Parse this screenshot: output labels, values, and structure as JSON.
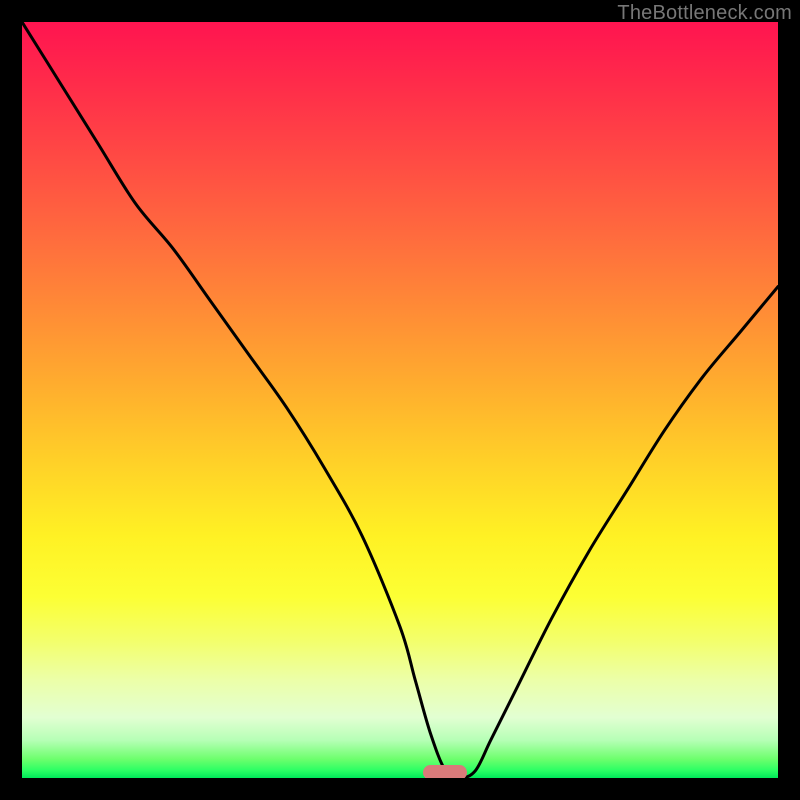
{
  "watermark": "TheBottleneck.com",
  "chart_data": {
    "type": "line",
    "title": "",
    "xlabel": "",
    "ylabel": "",
    "xlim": [
      0,
      100
    ],
    "ylim": [
      0,
      100
    ],
    "grid": false,
    "series": [
      {
        "name": "bottleneck-curve",
        "x": [
          0,
          5,
          10,
          15,
          20,
          25,
          30,
          35,
          40,
          45,
          50,
          52,
          54,
          56,
          58,
          60,
          62,
          65,
          70,
          75,
          80,
          85,
          90,
          95,
          100
        ],
        "y": [
          100,
          92,
          84,
          76,
          70,
          63,
          56,
          49,
          41,
          32,
          20,
          13,
          6,
          1,
          0,
          1,
          5,
          11,
          21,
          30,
          38,
          46,
          53,
          59,
          65
        ]
      }
    ],
    "background_gradient": {
      "stops": [
        {
          "pos": 0.0,
          "color": "#ff1450"
        },
        {
          "pos": 0.08,
          "color": "#ff2b4a"
        },
        {
          "pos": 0.18,
          "color": "#ff4a44"
        },
        {
          "pos": 0.28,
          "color": "#ff6a3e"
        },
        {
          "pos": 0.38,
          "color": "#ff8b36"
        },
        {
          "pos": 0.48,
          "color": "#ffad2e"
        },
        {
          "pos": 0.58,
          "color": "#ffd028"
        },
        {
          "pos": 0.68,
          "color": "#fff124"
        },
        {
          "pos": 0.76,
          "color": "#fcff34"
        },
        {
          "pos": 0.82,
          "color": "#f3ff6d"
        },
        {
          "pos": 0.87,
          "color": "#ecffa8"
        },
        {
          "pos": 0.92,
          "color": "#e2ffd2"
        },
        {
          "pos": 0.95,
          "color": "#b6ffb6"
        },
        {
          "pos": 0.975,
          "color": "#6dff6d"
        },
        {
          "pos": 0.99,
          "color": "#2bff64"
        },
        {
          "pos": 1.0,
          "color": "#00e85a"
        }
      ]
    },
    "marker": {
      "x": 56,
      "color": "#d97a7a"
    }
  }
}
